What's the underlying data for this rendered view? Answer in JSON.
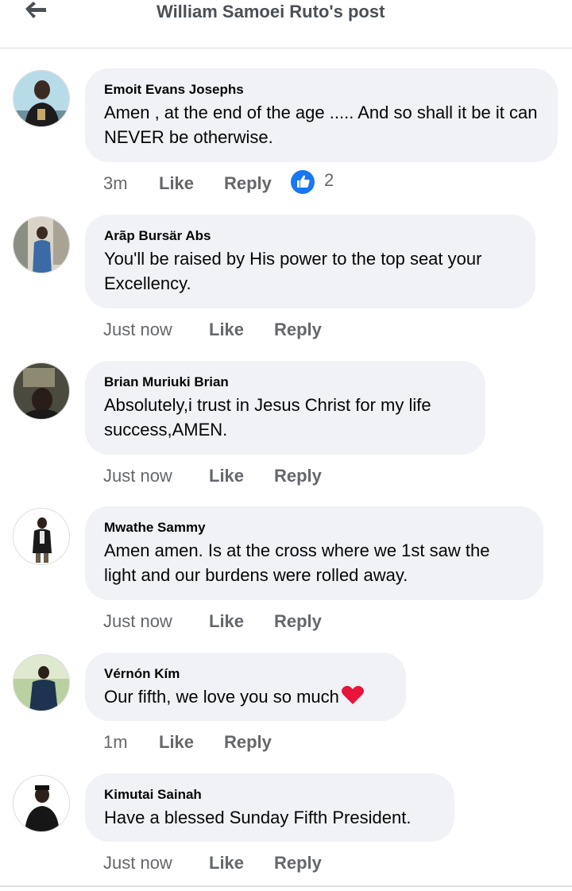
{
  "header": {
    "title": "William Samoei Ruto's post",
    "back_icon": "arrow-left-icon"
  },
  "colors": {
    "bubble": "#f0f2f5",
    "meta": "#65676b",
    "like_blue": "#1877f2",
    "heart": "#e8143b"
  },
  "comments": [
    {
      "author": "Emoit Evans Josephs",
      "text": "Amen , at the end of the age ..... And so shall it be it can NEVER be otherwise.",
      "time": "3m",
      "like": "Like",
      "reply": "Reply",
      "reaction_count": "2"
    },
    {
      "author": "Arãp Bursär Abs",
      "text": "You'll be raised by His power to the top seat your Excellency.",
      "time": "Just now",
      "like": "Like",
      "reply": "Reply"
    },
    {
      "author": "Brian Muriuki Brian",
      "text": "Absolutely,i trust in Jesus Christ for my life success,AMEN.",
      "time": "Just now",
      "like": "Like",
      "reply": "Reply"
    },
    {
      "author": "Mwathe Sammy",
      "text": "Amen amen. Is at the cross where we 1st saw the light and our burdens were rolled away.",
      "time": "Just now",
      "like": "Like",
      "reply": "Reply"
    },
    {
      "author": "Vérnón Kím",
      "text": "Our fifth, we love you so much",
      "time": "1m",
      "like": "Like",
      "reply": "Reply"
    },
    {
      "author": "Kimutai Sainah",
      "text": "Have a blessed Sunday Fifth President.",
      "time": "Just now",
      "like": "Like",
      "reply": "Reply"
    }
  ]
}
